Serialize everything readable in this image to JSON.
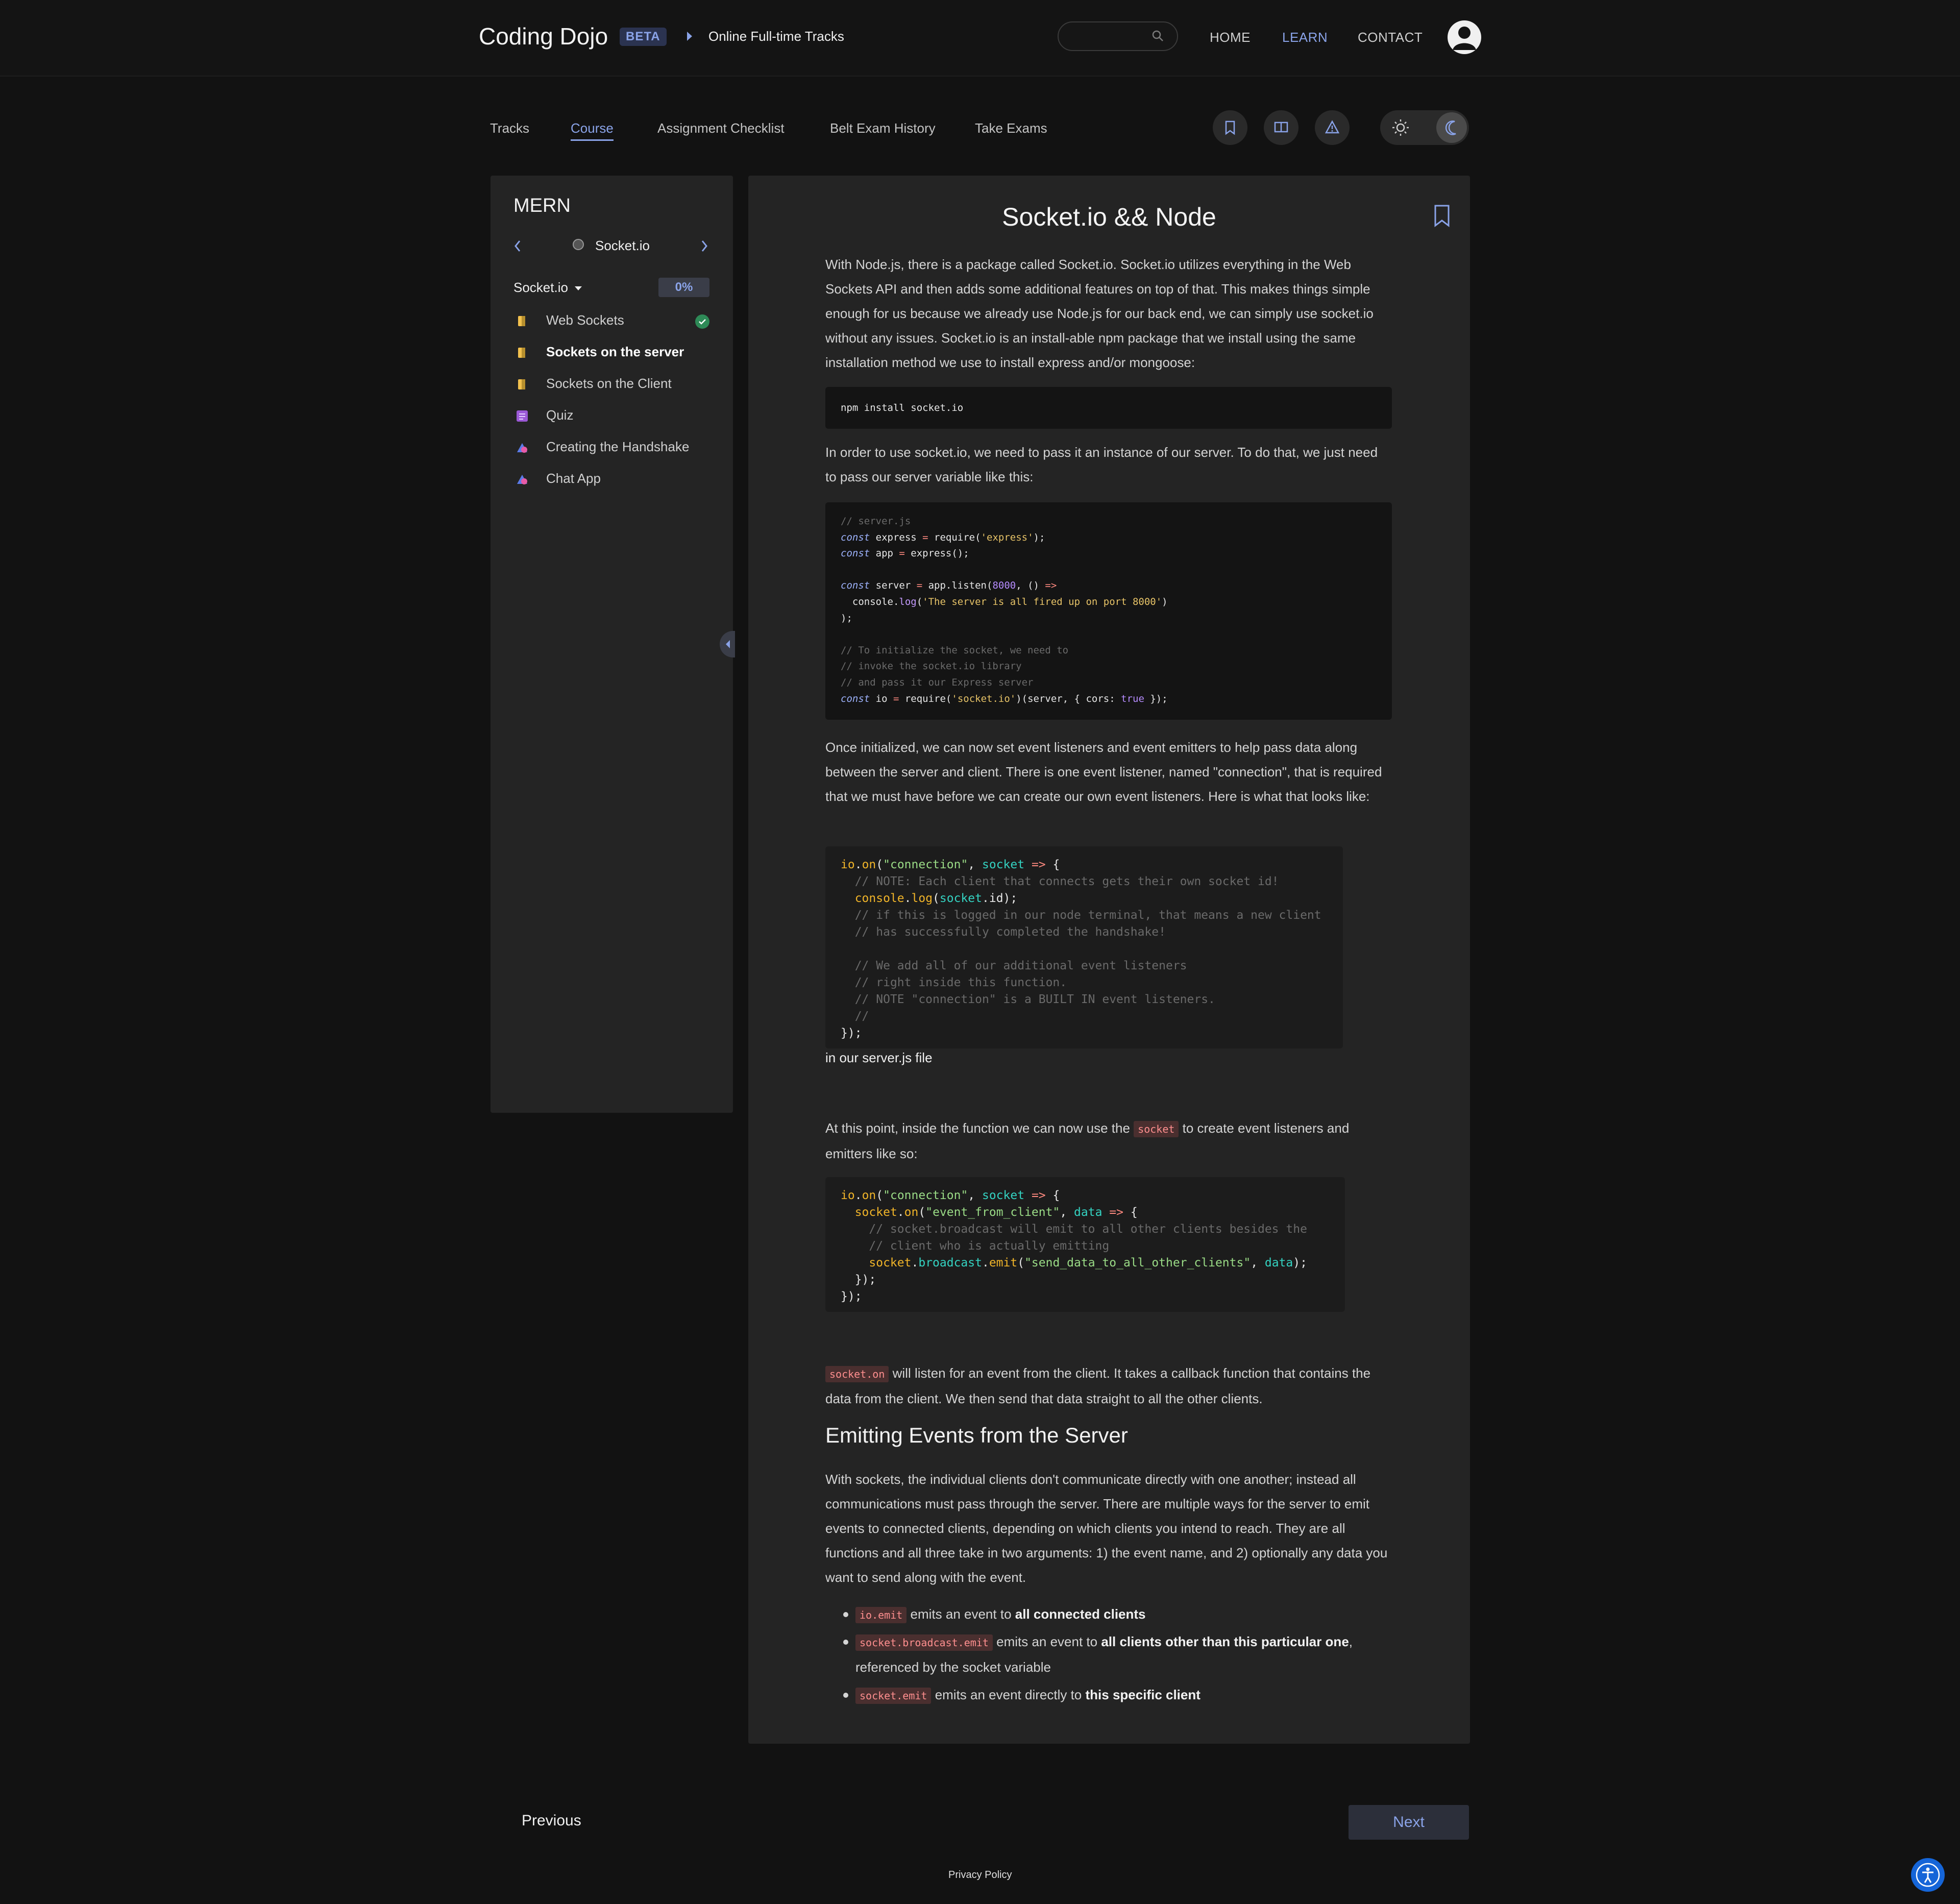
{
  "header": {
    "brand": "Coding Dojo",
    "badge": "BETA",
    "breadcrumb": "Online Full-time Tracks",
    "nav": [
      "HOME",
      "LEARN",
      "CONTACT"
    ]
  },
  "subnav": {
    "tabs": [
      "Tracks",
      "Course",
      "Assignment Checklist",
      "Belt Exam History",
      "Take Exams"
    ],
    "active_tab": "Course"
  },
  "sidebar": {
    "title": "MERN",
    "module": "Socket.io",
    "section": "Socket.io",
    "progress": "0%",
    "items": [
      {
        "label": "Web Sockets",
        "icon": "reading-icon",
        "done": true
      },
      {
        "label": "Sockets on the server",
        "icon": "reading-icon",
        "active": true
      },
      {
        "label": "Sockets on the Client",
        "icon": "reading-icon"
      },
      {
        "label": "Quiz",
        "icon": "quiz-icon"
      },
      {
        "label": "Creating the Handshake",
        "icon": "assignment-icon"
      },
      {
        "label": "Chat App",
        "icon": "assignment-icon"
      }
    ]
  },
  "article": {
    "title": "Socket.io && Node",
    "p1": "With Node.js, there is a package called Socket.io. Socket.io utilizes everything in the Web Sockets API and then adds some additional features on top of that. This makes things simple enough for us because we already use Node.js for our back end, we can simply use socket.io without any issues. Socket.io is an install-able npm package that we install using the same installation method we use to install express and/or mongoose:",
    "code1": "npm install socket.io",
    "p2": "In order to use socket.io, we need to pass it an instance of our server. To do that, we just need to pass our server variable like this:",
    "p3": "Once initialized, we can now set event listeners and event emitters to help pass data along between the server and client. There is one event listener, named \"connection\", that is required that we must have before we can create our own event listeners. Here is what that looks like:",
    "p4": "in our server.js file",
    "p5a": "At this point, inside the function we can now use the",
    "p5code": "socket",
    "p5b": "to create event listeners and emitters like so:",
    "p6code": "socket.on",
    "p6": "will listen for an event from the client. It takes a callback function that contains the data from the client. We then send that data straight to all the other clients.",
    "h2": "Emitting Events from the Server",
    "p7": "With sockets, the individual clients don't communicate directly with one another; instead all communications must pass through the server. There are multiple ways for the server to emit events to connected clients, depending on which clients you intend to reach. They are all functions and all three take in two arguments: 1) the event name, and 2) optionally any data you want to send along with the event.",
    "bullets": [
      {
        "code": "io.emit",
        "text": "emits an event to",
        "bold": "all connected clients",
        "rest": ""
      },
      {
        "code": "socket.broadcast.emit",
        "text": "emits an event to",
        "bold": "all clients other than this particular one",
        "rest": ", referenced by the socket variable"
      },
      {
        "code": "socket.emit",
        "text": "emits an event directly to",
        "bold": "this specific client",
        "rest": ""
      }
    ]
  },
  "footer": {
    "previous": "Previous",
    "next": "Next",
    "privacy": "Privacy Policy"
  }
}
